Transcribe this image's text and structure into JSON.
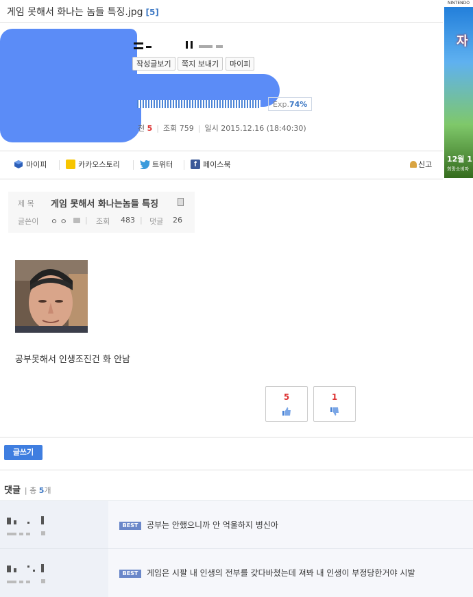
{
  "post": {
    "title": "게임 못해서 화나는 놈들 특징.jpg",
    "comment_count": "[5]"
  },
  "profile": {
    "buttons": [
      "작성글보기",
      "쪽지 보내기",
      "마이피"
    ],
    "exp_label": "Exp.",
    "exp_value": "74%",
    "exp_progress": 0.74,
    "recommend_label": "천",
    "recommend_value": "5",
    "views_label": "조회",
    "views_value": "759",
    "date_label": "일시",
    "date_value": "2015.12.16 (18:40:30)"
  },
  "share": {
    "mypi": "마이피",
    "kakao": "카카오스토리",
    "twitter": "트위터",
    "facebook": "페이스북",
    "report": "신고"
  },
  "info": {
    "title_label": "제 목",
    "title_value": "게임 못해서 화나는놈들 특징",
    "author_label": "글쓴이",
    "author_value": "ㅇ ㅇ",
    "views_label": "조회",
    "views_value": "483",
    "comments_label": "댓글",
    "comments_value": "26"
  },
  "content": {
    "text": "공부못해서 인생조진건 화 안남"
  },
  "votes": {
    "up": "5",
    "down": "1"
  },
  "write_button": "글쓰기",
  "comments": {
    "header": "댓글",
    "total_label": "총",
    "total_value": "5",
    "total_unit": "개",
    "best_badge": "BEST",
    "items": [
      "공부는 안했으니까 안 억울하지 병신아",
      "게임은 시팔 내 인생의 전부를 갖다바쳤는데 져봐 내 인생이 부정당한거야 시발"
    ]
  },
  "ad": {
    "brand": "NINTENDO",
    "headline": "자",
    "date": "12월 1",
    "sub": "희망소비자"
  },
  "colors": {
    "accent": "#3d78c4",
    "button_blue": "#3f7ee0",
    "vote_red": "#dd3333",
    "redaction_blue": "#5b8cf7"
  }
}
